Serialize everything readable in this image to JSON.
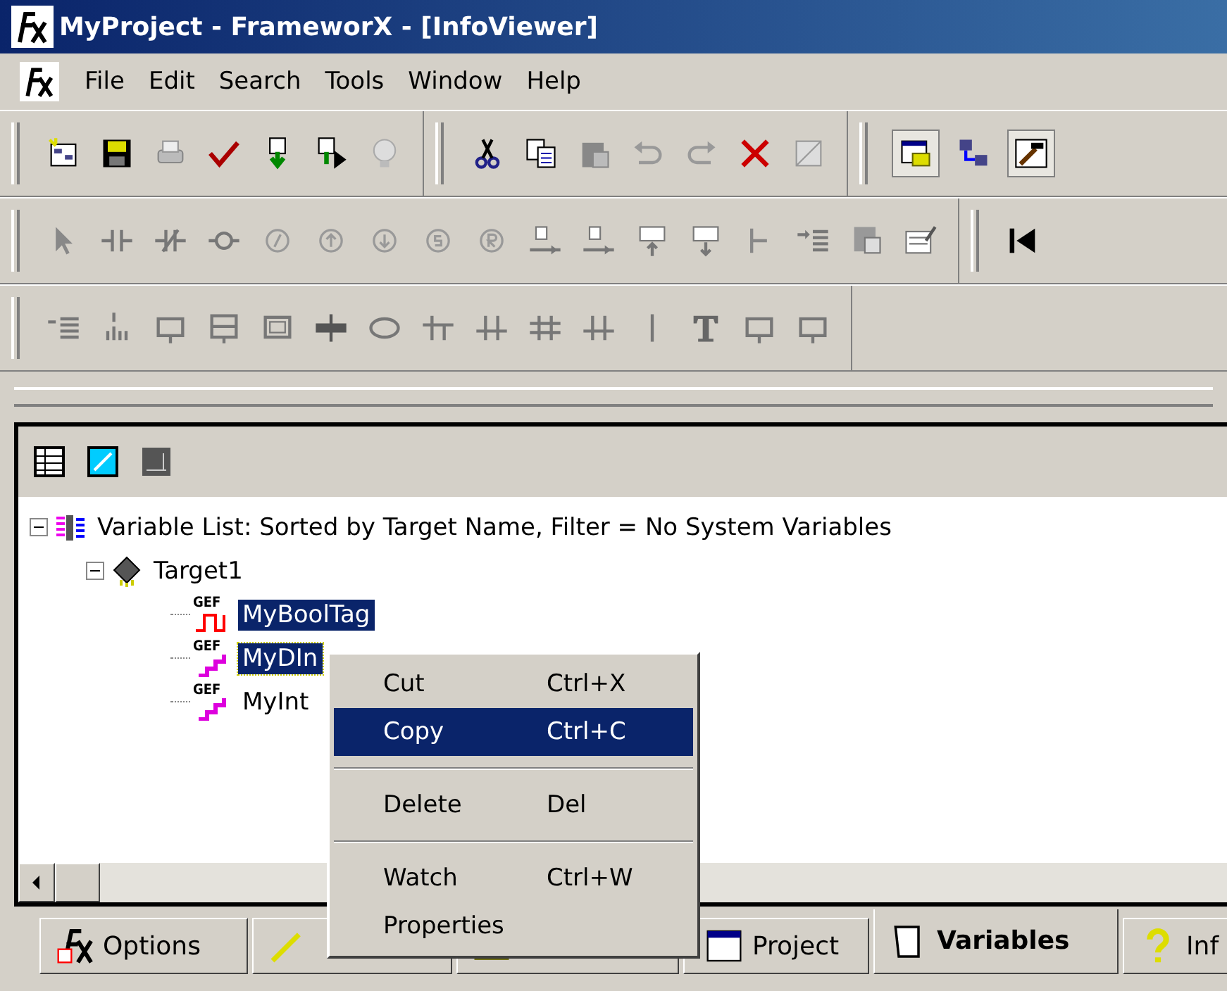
{
  "window": {
    "title": "MyProject - FrameworX - [InfoViewer]"
  },
  "menu": [
    {
      "label": "File"
    },
    {
      "label": "Edit"
    },
    {
      "label": "Search"
    },
    {
      "label": "Tools"
    },
    {
      "label": "Window"
    },
    {
      "label": "Help"
    }
  ],
  "tree": {
    "label": "Variable List: Sorted by Target Name, Filter = No System Variables",
    "expanded": true,
    "children": [
      {
        "label": "Target1",
        "expanded": true,
        "children": [
          {
            "label": "MyBoolTag",
            "selected": true,
            "kind": "bool",
            "tag": "GEF"
          },
          {
            "label": "MyDIn",
            "selected": true,
            "kind": "int",
            "tag": "GEF"
          },
          {
            "label": "MyInt",
            "selected": false,
            "kind": "int",
            "tag": "GEF"
          }
        ]
      }
    ]
  },
  "context_menu": [
    {
      "label": "Cut",
      "shortcut": "Ctrl+X",
      "selected": false,
      "kind": "item"
    },
    {
      "label": "Copy",
      "shortcut": "Ctrl+C",
      "selected": true,
      "kind": "item"
    },
    {
      "kind": "separator"
    },
    {
      "label": "Delete",
      "shortcut": "Del",
      "selected": false,
      "kind": "item"
    },
    {
      "kind": "separator"
    },
    {
      "label": "Watch",
      "shortcut": "Ctrl+W",
      "selected": false,
      "kind": "item"
    },
    {
      "label": "Properties",
      "selected": false,
      "kind": "item"
    }
  ],
  "tabs": [
    {
      "label": "Options",
      "selected": false
    },
    {
      "selected": false
    },
    {
      "selected": false
    },
    {
      "label": "Project",
      "selected": false
    },
    {
      "label": "Variables",
      "selected": true
    },
    {
      "label": "Inf",
      "selected": false
    }
  ]
}
